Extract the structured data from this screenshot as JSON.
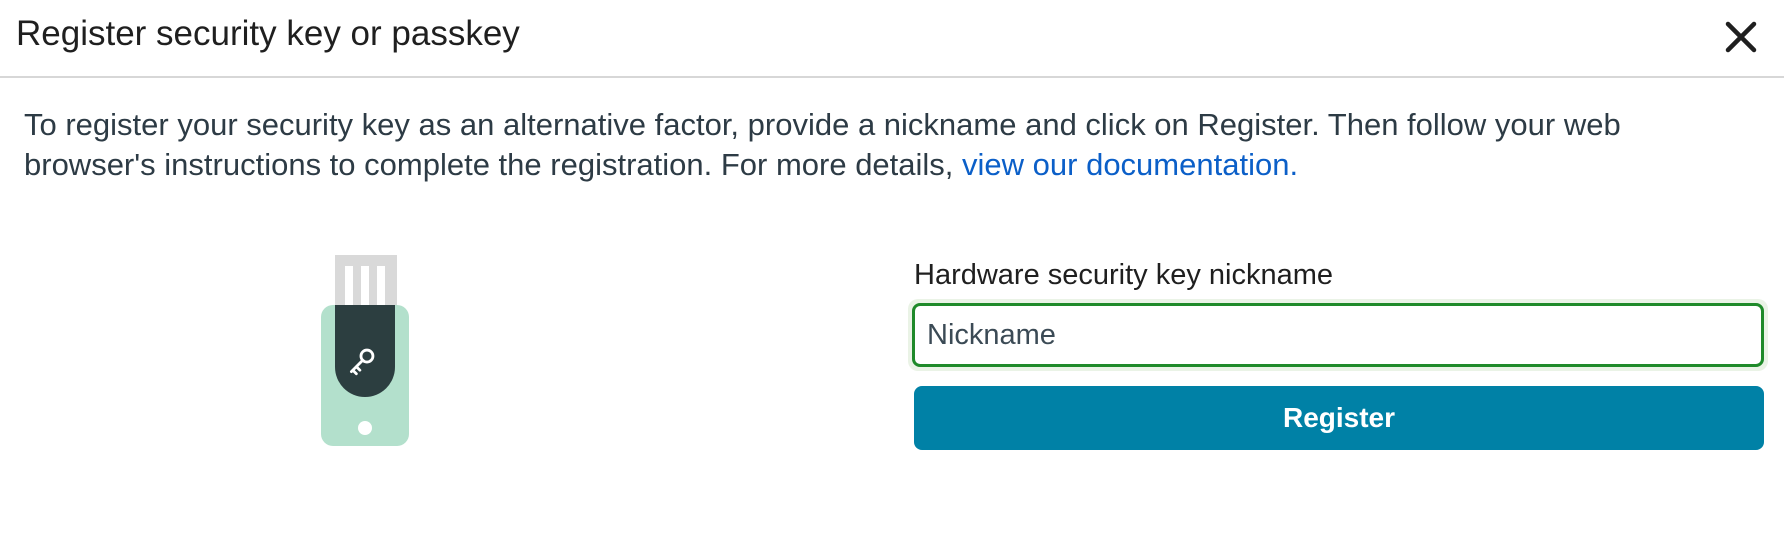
{
  "dialog": {
    "title": "Register security key or passkey",
    "close_icon": "close-icon"
  },
  "intro": {
    "text": "To register your security key as an alternative factor, provide a nickname and click on Register. Then follow your web browser's instructions to complete the registration. For more details, ",
    "link_text": "view our documentation."
  },
  "illustration": {
    "icon": "usb-security-key-icon",
    "colors": {
      "connector": "#d9d9d9",
      "body": "#b3e0cc",
      "cap": "#2c3e40"
    }
  },
  "form": {
    "label": "Hardware security key nickname",
    "placeholder": "Nickname",
    "value": "",
    "register_label": "Register"
  },
  "colors": {
    "button": "#0081a6",
    "link": "#0b5fc8",
    "input_focus_border": "#1f8a2a"
  }
}
